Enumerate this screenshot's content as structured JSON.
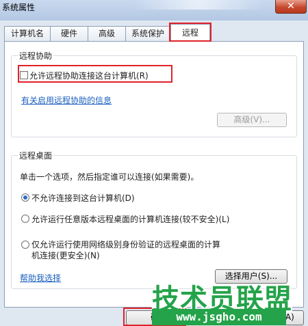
{
  "window": {
    "title": "系统属性",
    "close_glyph": "✕"
  },
  "tabs": [
    {
      "label": "计算机名"
    },
    {
      "label": "硬件"
    },
    {
      "label": "高级"
    },
    {
      "label": "系统保护"
    },
    {
      "label": "远程",
      "active": true
    }
  ],
  "remote_assistance": {
    "group_title": "远程协助",
    "allow_checkbox_label": "允许远程协助连接这台计算机(R)",
    "allow_checked": false,
    "info_link": "有关启用远程协助的信息",
    "advanced_button": "高级(V)..."
  },
  "remote_desktop": {
    "group_title": "远程桌面",
    "instruction": "单击一个选项，然后指定谁可以连接(如果需要)。",
    "options": [
      {
        "label": "不允许连接到这台计算机(D)",
        "checked": true
      },
      {
        "label": "允许运行任意版本远程桌面的计算机连接(较不安全)(L)",
        "checked": false
      },
      {
        "label_line1": "仅允许运行使用网络级别身份验证的远程桌面的计算",
        "label_line2": "机连接(更安全)(N)",
        "checked": false
      }
    ],
    "help_link": "帮助我选择",
    "select_users_button": "选择用户(S)..."
  },
  "footer": {
    "ok_button": "确",
    "apply_button": "(A)"
  },
  "watermark": {
    "text": "技术员联盟",
    "url": "www.jsgho.com"
  },
  "colors": {
    "highlight": "#e0212a",
    "link": "#1b5fbf",
    "watermark": "#24a34a"
  }
}
